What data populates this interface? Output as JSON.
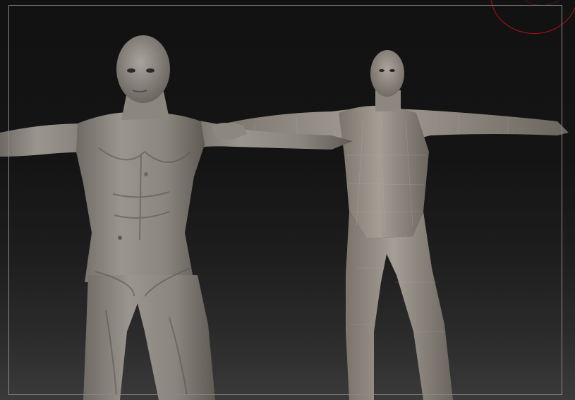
{
  "viewport": {
    "background_top": "#121212",
    "background_bottom": "#3a3a3a",
    "frame_color": "#8a8a8a",
    "brush_cursor_color": "#b0101a"
  },
  "models": [
    {
      "name": "sculpted-high-poly-figure",
      "material_color": "#8e8982"
    },
    {
      "name": "low-poly-base-mesh-figure",
      "material_color": "#9a948b"
    }
  ]
}
